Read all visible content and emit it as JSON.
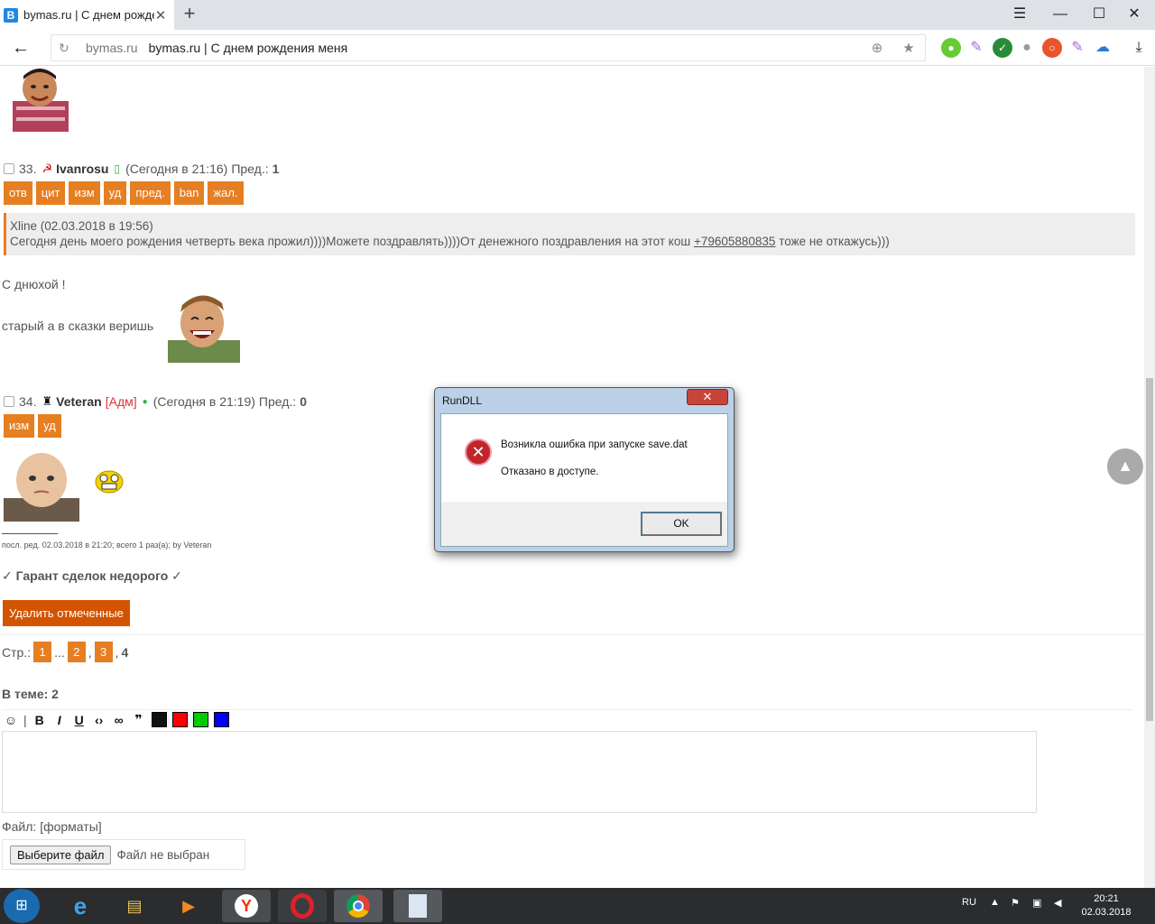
{
  "browser": {
    "tab_title": "bymas.ru | С днем рожде",
    "tab_favicon": "B",
    "new_tab": "+",
    "url_domain": "bymas.ru",
    "url_title": "bymas.ru | С днем рождения меня"
  },
  "posts": [
    {
      "number": "33.",
      "user": "Ivanrosu",
      "time": "(Сегодня в 21:16)",
      "pred_label": "Пред.:",
      "pred_value": "1",
      "buttons": [
        "отв",
        "цит",
        "изм",
        "уд",
        "пред.",
        "ban",
        "жал."
      ],
      "quote_line1": "Xline (02.03.2018 в 19:56)",
      "quote_line2a": "Сегодня день моего рождения четверть века прожил))))Можете поздравлять))))От денежного поздравления на этот кош ",
      "quote_phone": "+79605880835",
      "quote_line2b": " тоже не откажусь)))",
      "text1": "С днюхой !",
      "text2": "старый а в сказки веришь"
    },
    {
      "number": "34.",
      "user": "Veteran",
      "role": "[Адм]",
      "time": "(Сегодня в 21:19)",
      "pred_label": "Пред.:",
      "pred_value": "0",
      "buttons": [
        "изм",
        "уд"
      ],
      "edit_note": "посл. ред. 02.03.2018 в 21:20; всего 1 раз(а); by Veteran",
      "signature": "✓ Гарант сделок недорого ✓"
    }
  ],
  "delete_button": "Удалить отмеченные",
  "pager": {
    "label": "Стр.:",
    "pages": [
      "1",
      "2",
      "3"
    ],
    "ellipsis": "...",
    "current": "4"
  },
  "in_topic": "В теме: 2",
  "editor": {
    "colors": [
      "#ff0000",
      "#00cc00",
      "#0000ff"
    ]
  },
  "file": {
    "label": "Файл: [форматы]",
    "button": "Выберите файл",
    "status": "Файл не выбран"
  },
  "dialog": {
    "title": "RunDLL",
    "message": "Возникла ошибка при запуске save.dat",
    "detail": "Отказано в доступе.",
    "ok": "OK"
  },
  "taskbar": {
    "lang": "RU",
    "time": "20:21",
    "date": "02.03.2018"
  }
}
